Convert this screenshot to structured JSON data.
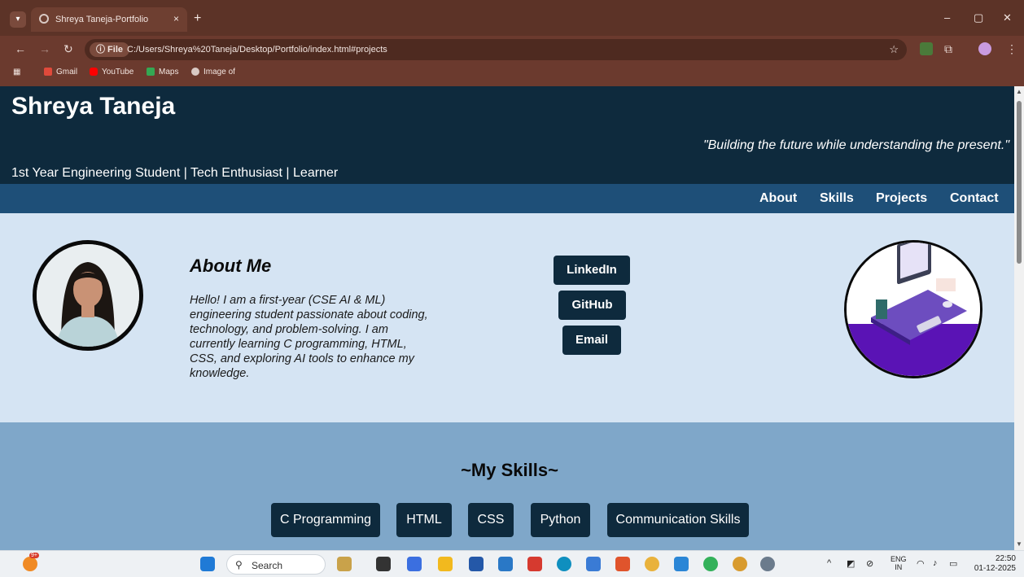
{
  "browser": {
    "tab_title": "Shreya Taneja-Portfolio",
    "tab_close": "×",
    "new_tab": "+",
    "file_chip": "ⓘ File",
    "url": "C:/Users/Shreya%20Taneja/Desktop/Portfolio/index.html#projects",
    "bookmarks": [
      "Gmail",
      "YouTube",
      "Maps",
      "Image of"
    ]
  },
  "site": {
    "name": "Shreya Taneja",
    "quote": "\"Building the future while understanding the present.\"",
    "tagline": "1st Year Engineering Student | Tech Enthusiast | Learner",
    "nav": [
      "About",
      "Skills",
      "Projects",
      "Contact"
    ]
  },
  "about": {
    "heading": "About Me",
    "text": "Hello! I am a first-year (CSE AI & ML) engineering student passionate about coding, technology, and problem-solving. I am currently learning C programming, HTML, CSS, and exploring AI tools to enhance my knowledge.",
    "links": [
      "LinkedIn",
      "GitHub",
      "Email"
    ]
  },
  "skills": {
    "heading": "~My Skills~",
    "items": [
      "C Programming",
      "HTML",
      "CSS",
      "Python",
      "Communication Skills"
    ]
  },
  "taskbar": {
    "search_label": "Search",
    "lang_top": "ENG",
    "lang_bottom": "IN",
    "time": "22:50",
    "date": "01-12-2025",
    "badge": "9+"
  },
  "colors": {
    "header_bg": "#0e2a3d",
    "nav_bg": "#1e4f78",
    "about_bg": "#d5e4f3",
    "skills_bg": "#7fa7c9",
    "chrome_bg": "#6b3a2e"
  }
}
